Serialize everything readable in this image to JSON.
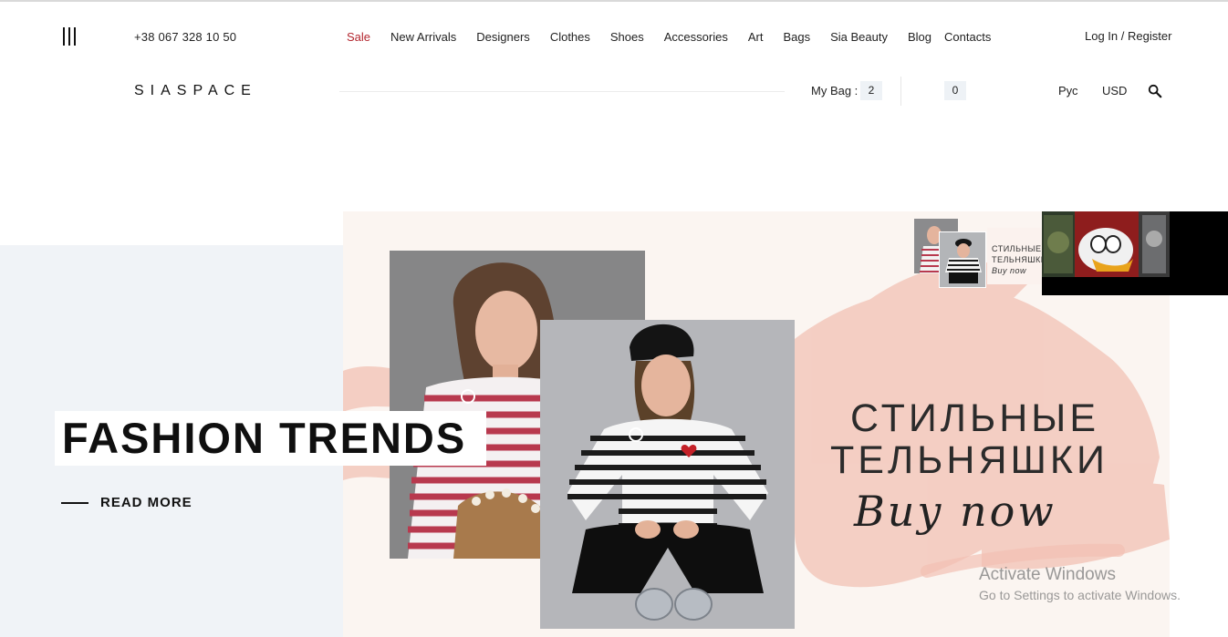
{
  "header": {
    "phone": "+38 067 328 10 50",
    "nav": [
      "Sale",
      "New Arrivals",
      "Designers",
      "Clothes",
      "Shoes",
      "Accessories",
      "Art",
      "Bags",
      "Sia Beauty",
      "Blog",
      "Contacts"
    ],
    "login": "Log In",
    "auth_sep": " / ",
    "register": "Register",
    "logo": "SIASPACE",
    "bag_label": "My Bag :",
    "bag_count": "2",
    "wishlist_count": "0",
    "language": "Рус",
    "currency": "USD",
    "icons": [
      "menu-icon",
      "search-icon"
    ]
  },
  "hero": {
    "title": "FASHION TRENDS",
    "read_more": "READ MORE",
    "banner_line1": "СТИЛЬНЫЕ",
    "banner_line2": "ТЕЛЬНЯШКИ",
    "banner_cta": "Buy now"
  },
  "thumbnails": {
    "text_line1": "СТИЛЬНЫЕ",
    "text_line2": "ТЕЛЬНЯШКИ",
    "text_line3": "Buy now"
  },
  "overlay": {
    "activate_title": "Activate Windows",
    "activate_sub": "Go to Settings to activate Windows."
  },
  "colors": {
    "sale": "#b3262e",
    "hero_left_bg": "#f0f3f7",
    "banner_bg": "#fbf5f1",
    "brush": "#f2c1b4"
  }
}
